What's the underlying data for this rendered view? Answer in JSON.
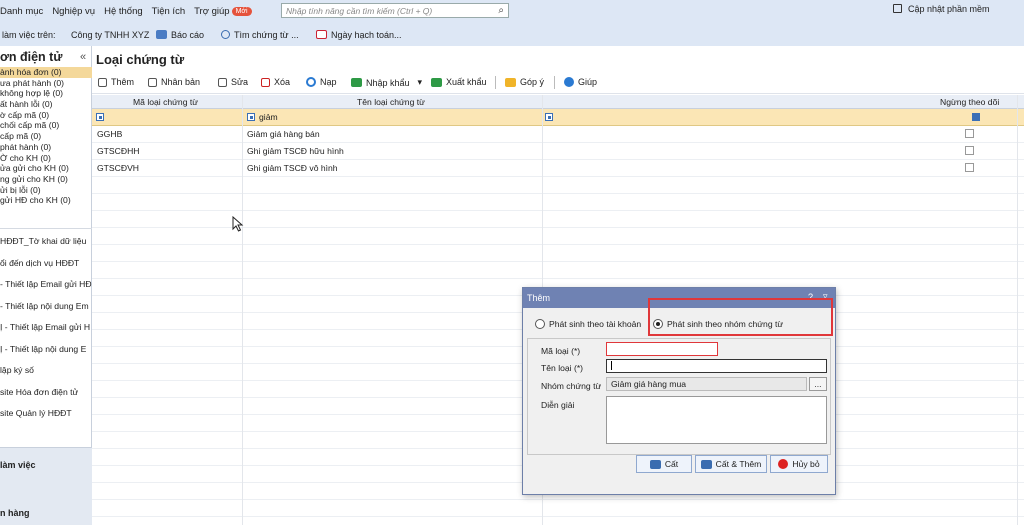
{
  "menu": [
    "Danh mục",
    "Nghiệp vụ",
    "Hệ thống",
    "Tiện ích",
    "Trợ giúp"
  ],
  "new_badge": "Mới",
  "search": {
    "placeholder": "Nhập tính năng cần tìm kiếm (Ctrl + Q)"
  },
  "update_label": "Cập nhật phần mềm",
  "row2": {
    "workplace_label": "làm việc trên:",
    "company": "Công ty TNHH XYZ",
    "report": "Báo cáo",
    "find_doc": "Tìm chứng từ ...",
    "accounting_date": "Ngày hạch toán..."
  },
  "sidebar": {
    "title": "ơn điện tử",
    "items": [
      "ành hóa đơn (0)",
      "ưa phát hành (0)",
      " không hợp lệ (0)",
      "ất hành lỗi (0)",
      "ờ cấp mã (0)",
      " chối cấp mã (0)",
      " cấp mã (0)",
      " phát hành (0)",
      "Ờ cho KH (0)",
      "ửa gửi cho KH (0)",
      "ng gửi cho KH (0)",
      "ửi bị lỗi (0)",
      " gửi HĐ cho KH (0)"
    ],
    "sections": [
      "HĐĐT_Tờ khai dữ liệu",
      "ổi đến dịch vụ HĐĐT",
      " - Thiết lập Email gửi HĐ",
      " - Thiết lập nội dung Em",
      "Ị - Thiết lập Email gửi H",
      "Ị - Thiết lập nội dung E",
      "lập ký số",
      "site Hóa đơn điện tử",
      "site Quản lý HĐĐT"
    ],
    "footer": [
      "làm việc",
      "n hàng"
    ]
  },
  "page_title": "Loại chứng từ",
  "toolbar": {
    "add": "Thêm",
    "duplicate": "Nhân bản",
    "edit": "Sửa",
    "delete": "Xóa",
    "reload": "Nạp",
    "import": "Nhập khẩu",
    "export": "Xuất khẩu",
    "feedback": "Góp ý",
    "help": "Giúp"
  },
  "grid": {
    "columns": [
      "Mã loại chứng từ",
      "Tên loại chứng từ",
      "Ngừng theo dõi"
    ],
    "filter_name": "giảm",
    "rows": [
      {
        "code": "GGHB",
        "name": "Giảm giá hàng bán"
      },
      {
        "code": "GTSCĐHH",
        "name": "Ghi giảm TSCĐ hữu hình"
      },
      {
        "code": "GTSCĐVH",
        "name": "Ghi giảm TSCĐ vô hình"
      }
    ]
  },
  "dialog": {
    "title": "Thêm",
    "help_glyph": "?",
    "collapse_glyph": "▿",
    "radio_account": "Phát sinh theo tài khoản",
    "radio_group": "Phát sinh theo nhóm chứng từ",
    "label_code": "Mã loại (*)",
    "label_name": "Tên loại (*)",
    "label_group": "Nhóm chứng từ",
    "label_desc": "Diễn giải",
    "group_value": "Giảm giá hàng mua",
    "browse": "...",
    "save": "Cất",
    "save_add": "Cất & Thêm",
    "cancel": "Hủy bỏ"
  }
}
